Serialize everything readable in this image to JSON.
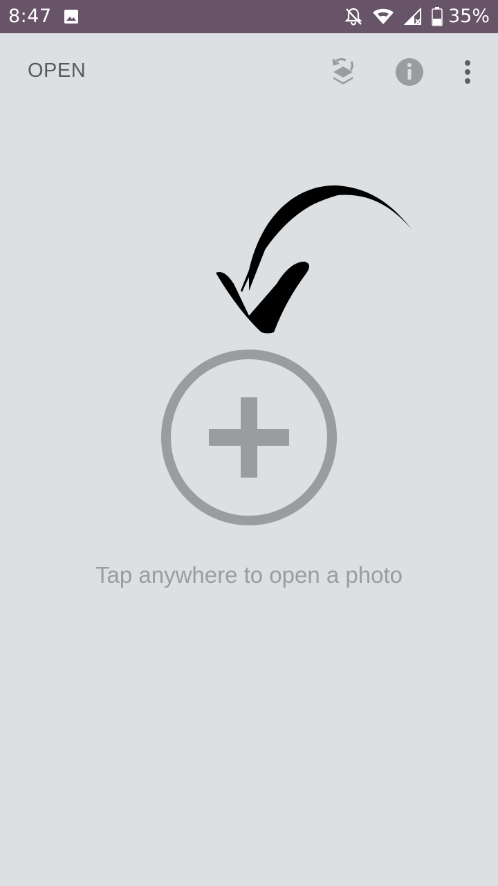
{
  "status_bar": {
    "time": "8:47",
    "battery_percent": "35%",
    "icons": [
      "image-icon",
      "notifications-off-icon",
      "wifi-icon",
      "signal-no-data-icon",
      "battery-icon"
    ]
  },
  "app_bar": {
    "open_label": "OPEN",
    "icons": [
      "layers-switch-icon",
      "info-icon",
      "more-vert-icon"
    ]
  },
  "main": {
    "hint_text": "Tap anywhere to open a photo",
    "add_icon": "add-circle-icon",
    "arrow_icon": "curved-arrow-icon"
  },
  "colors": {
    "status_bar": "#685468",
    "background": "#dce0e3",
    "accent_gray": "#9a9da0"
  }
}
